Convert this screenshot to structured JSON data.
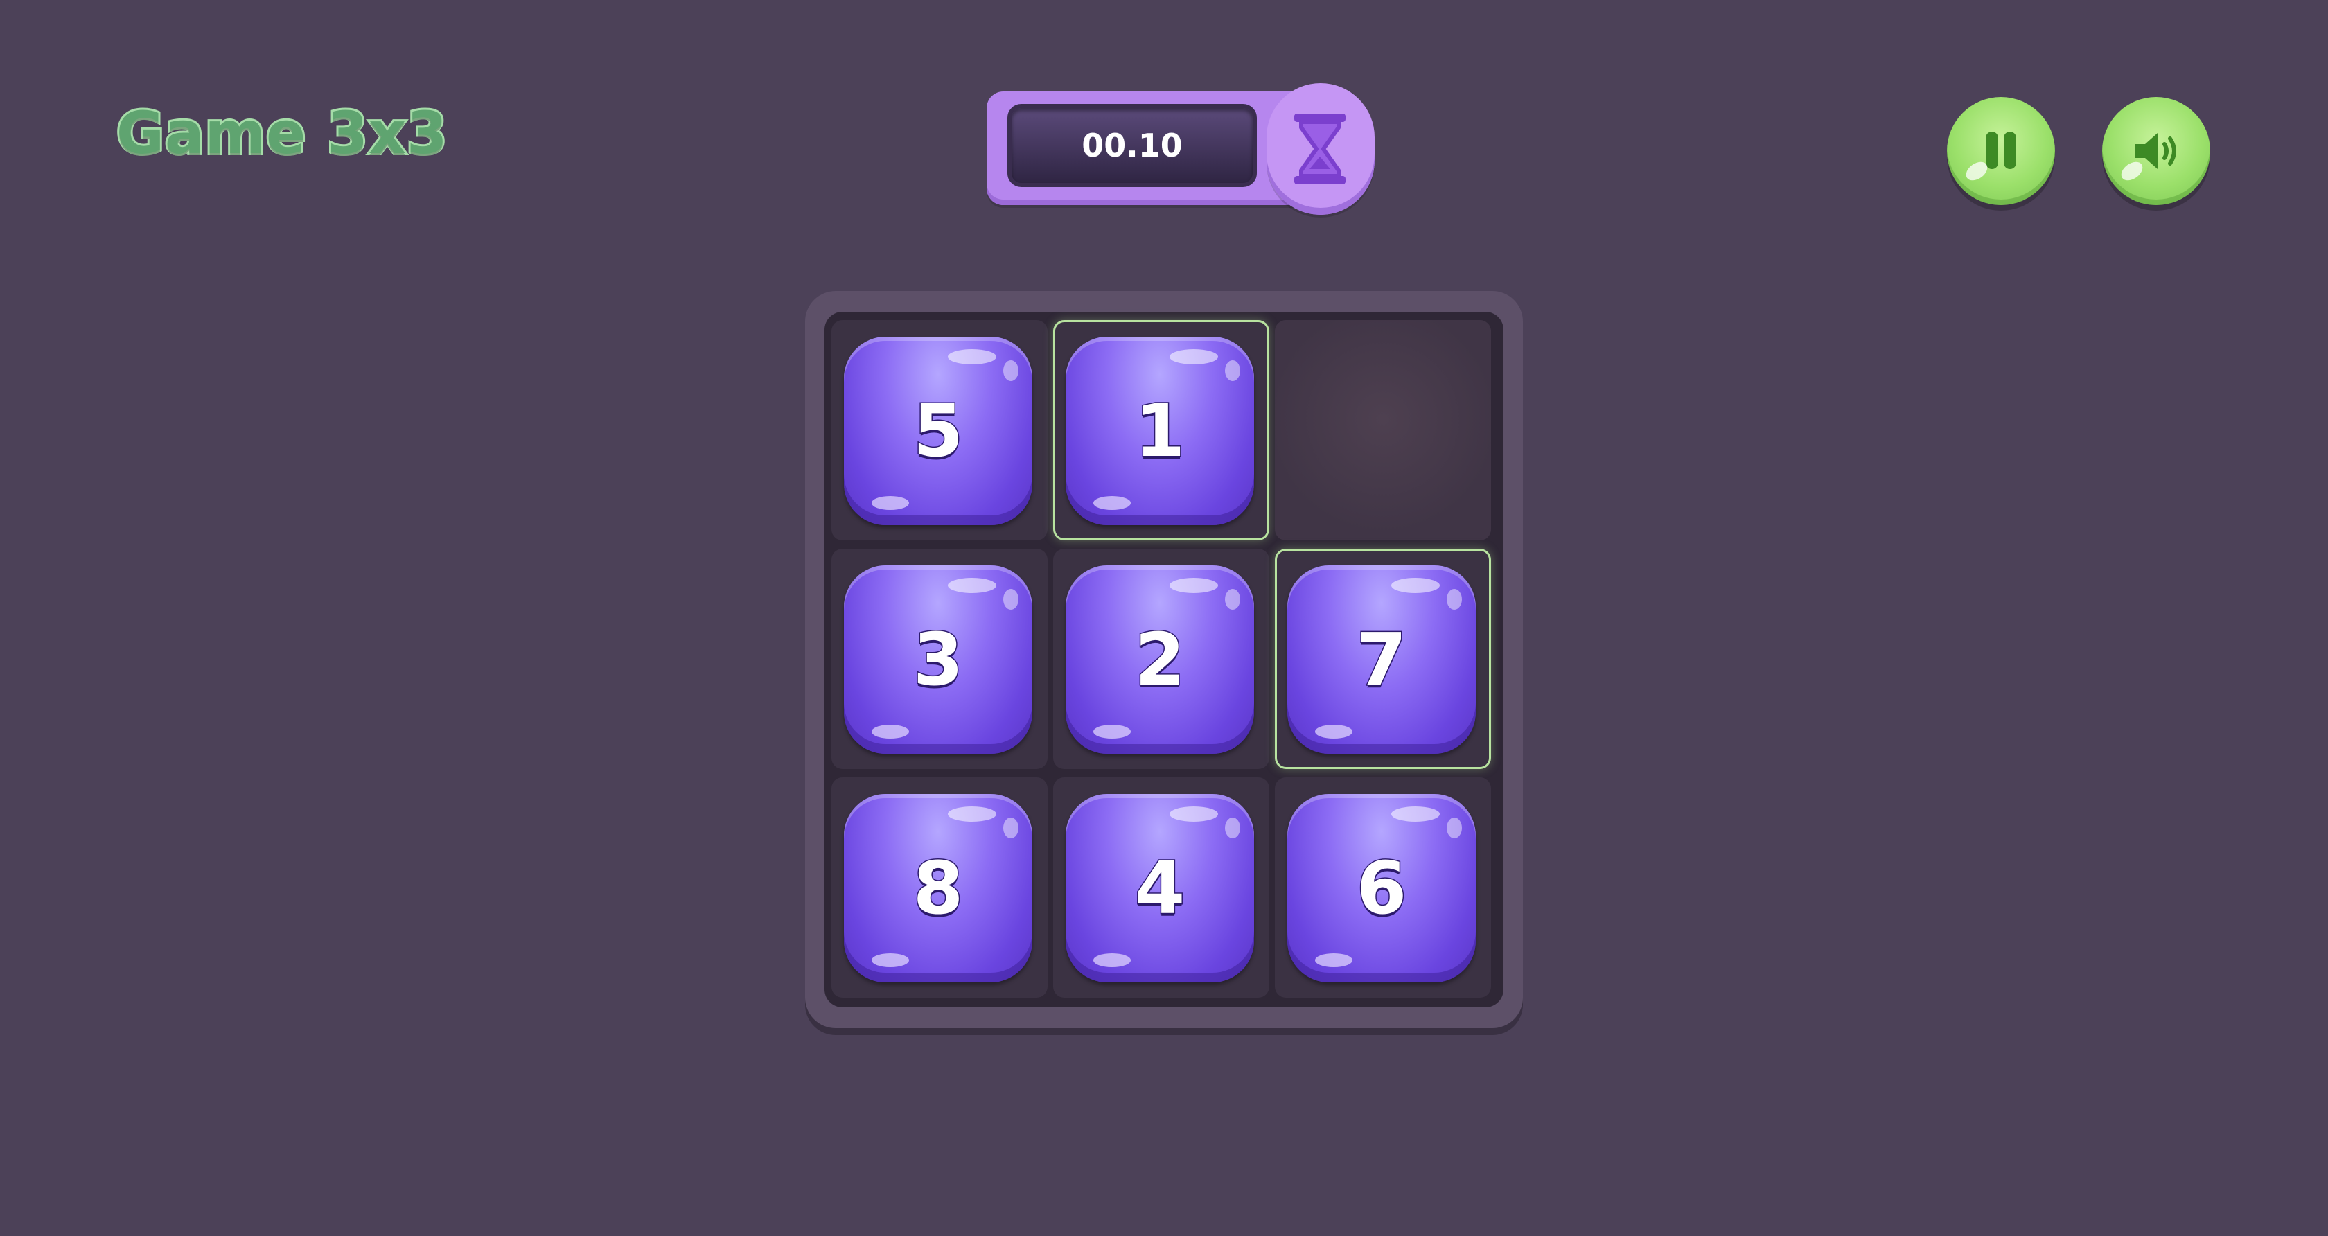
{
  "title": "Game 3x3",
  "timer": {
    "value": "00.10",
    "icon": "hourglass-icon"
  },
  "controls": {
    "pause_icon": "pause-icon",
    "sound_icon": "speaker-icon"
  },
  "colors": {
    "background": "#4c4158",
    "tile": "#7a55ea",
    "button": "#9be06a",
    "timer": "#b686ee",
    "title": "#5fa470"
  },
  "board": {
    "rows": 3,
    "cols": 3,
    "tiles": [
      [
        "5",
        "1",
        ""
      ],
      [
        "3",
        "2",
        "7"
      ],
      [
        "8",
        "4",
        "6"
      ]
    ],
    "highlighted_cells": [
      "1",
      "7"
    ]
  }
}
